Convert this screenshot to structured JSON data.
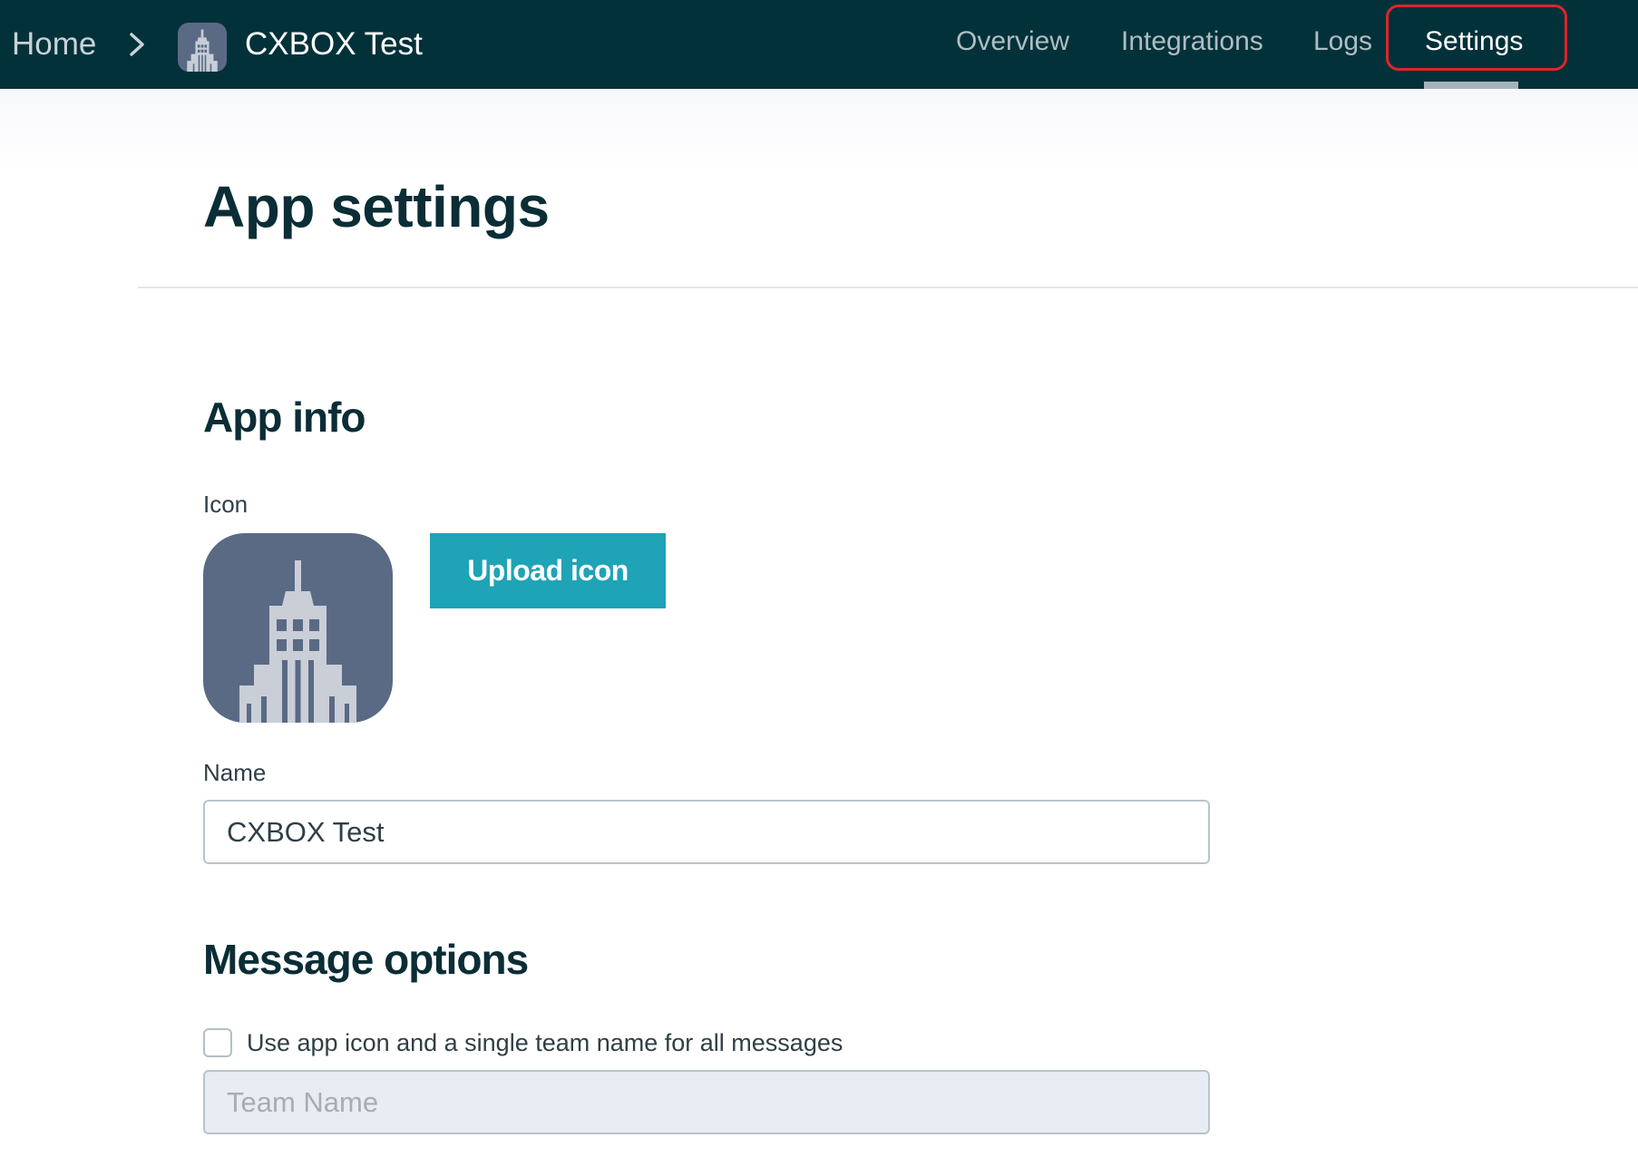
{
  "breadcrumb": {
    "home": "Home",
    "app_name": "CXBOX Test"
  },
  "nav": {
    "tabs": [
      {
        "label": "Overview",
        "active": false
      },
      {
        "label": "Integrations",
        "active": false
      },
      {
        "label": "Logs",
        "active": false
      },
      {
        "label": "Settings",
        "active": true
      }
    ]
  },
  "page": {
    "title": "App settings"
  },
  "app_info": {
    "heading": "App info",
    "icon_label": "Icon",
    "icon_semantic": "building-icon",
    "upload_button": "Upload icon",
    "name_label": "Name",
    "name_value": "CXBOX Test"
  },
  "message_options": {
    "heading": "Message options",
    "checkbox_label": "Use app icon and a single team name for all messages",
    "checkbox_checked": false,
    "team_name_placeholder": "Team Name"
  },
  "colors": {
    "topbar": "#03313a",
    "accent": "#1fa3b6",
    "icon_bg": "#5a6a84",
    "highlight": "#e0242b"
  }
}
